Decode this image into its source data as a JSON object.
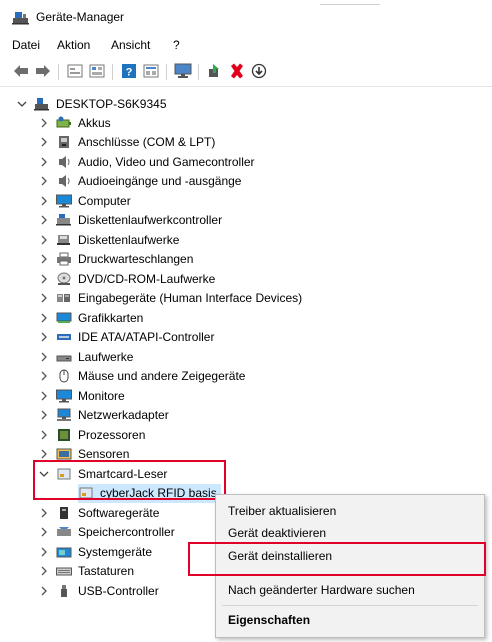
{
  "window": {
    "title": "Geräte-Manager"
  },
  "menu": {
    "items": [
      "Datei",
      "Aktion",
      "Ansicht",
      "?"
    ]
  },
  "toolbar": {
    "buttons": [
      "back-icon",
      "forward-icon",
      "properties-icon",
      "grid-icon",
      "help-icon",
      "device-view-icon",
      "monitor-icon",
      "enable-device-icon",
      "uninstall-icon",
      "update-driver-icon"
    ]
  },
  "tree": {
    "root": {
      "label": "DESKTOP-S6K9345",
      "icon": "computer-network-icon"
    },
    "items": [
      {
        "label": "Akkus",
        "icon": "battery-icon"
      },
      {
        "label": "Anschlüsse (COM & LPT)",
        "icon": "port-icon"
      },
      {
        "label": "Audio, Video und Gamecontroller",
        "icon": "speaker-icon"
      },
      {
        "label": "Audioeingänge und -ausgänge",
        "icon": "speaker-icon"
      },
      {
        "label": "Computer",
        "icon": "monitor-icon"
      },
      {
        "label": "Diskettenlaufwerkcontroller",
        "icon": "floppy-controller-icon"
      },
      {
        "label": "Diskettenlaufwerke",
        "icon": "floppy-icon"
      },
      {
        "label": "Druckwarteschlangen",
        "icon": "printer-icon"
      },
      {
        "label": "DVD/CD-ROM-Laufwerke",
        "icon": "disc-icon"
      },
      {
        "label": "Eingabegeräte (Human Interface Devices)",
        "icon": "hid-icon"
      },
      {
        "label": "Grafikkarten",
        "icon": "display-adapter-icon"
      },
      {
        "label": "IDE ATA/ATAPI-Controller",
        "icon": "ide-icon"
      },
      {
        "label": "Laufwerke",
        "icon": "drive-icon"
      },
      {
        "label": "Mäuse und andere Zeigegeräte",
        "icon": "mouse-icon"
      },
      {
        "label": "Monitore",
        "icon": "monitor-icon"
      },
      {
        "label": "Netzwerkadapter",
        "icon": "network-icon"
      },
      {
        "label": "Prozessoren",
        "icon": "cpu-icon"
      },
      {
        "label": "Sensoren",
        "icon": "sensor-icon"
      },
      {
        "label": "Smartcard-Leser",
        "icon": "smartcard-icon",
        "expanded": true
      },
      {
        "label": "cyberJack RFID basis",
        "icon": "smartcard-icon",
        "child": true,
        "selected": true
      },
      {
        "label": "Softwaregeräte",
        "icon": "software-icon"
      },
      {
        "label": "Speichercontroller",
        "icon": "storage-icon"
      },
      {
        "label": "Systemgeräte",
        "icon": "system-icon"
      },
      {
        "label": "Tastaturen",
        "icon": "keyboard-icon"
      },
      {
        "label": "USB-Controller",
        "icon": "usb-icon"
      }
    ]
  },
  "context_menu": {
    "items": [
      {
        "label": "Treiber aktualisieren"
      },
      {
        "label": "Gerät deaktivieren"
      },
      {
        "label": "Gerät deinstallieren",
        "highlighted": true
      },
      {
        "label": "Nach geänderter Hardware suchen"
      },
      {
        "label": "Eigenschaften",
        "bold": true
      }
    ]
  },
  "colors": {
    "highlight_box": "#e0002a",
    "selection": "#cce8ff",
    "icon_blue": "#1e73be"
  }
}
